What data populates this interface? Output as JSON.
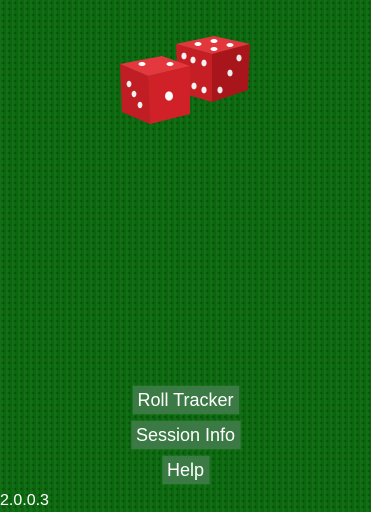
{
  "app": {
    "logo_icon": "red-dice-icon",
    "background_color": "#0a6a0e",
    "button_color": "#3c7a45",
    "dice_color": "#cc1c24"
  },
  "menu": {
    "roll_tracker": "Roll Tracker",
    "session_info": "Session Info",
    "help": "Help"
  },
  "footer": {
    "version": "2.0.0.3"
  }
}
